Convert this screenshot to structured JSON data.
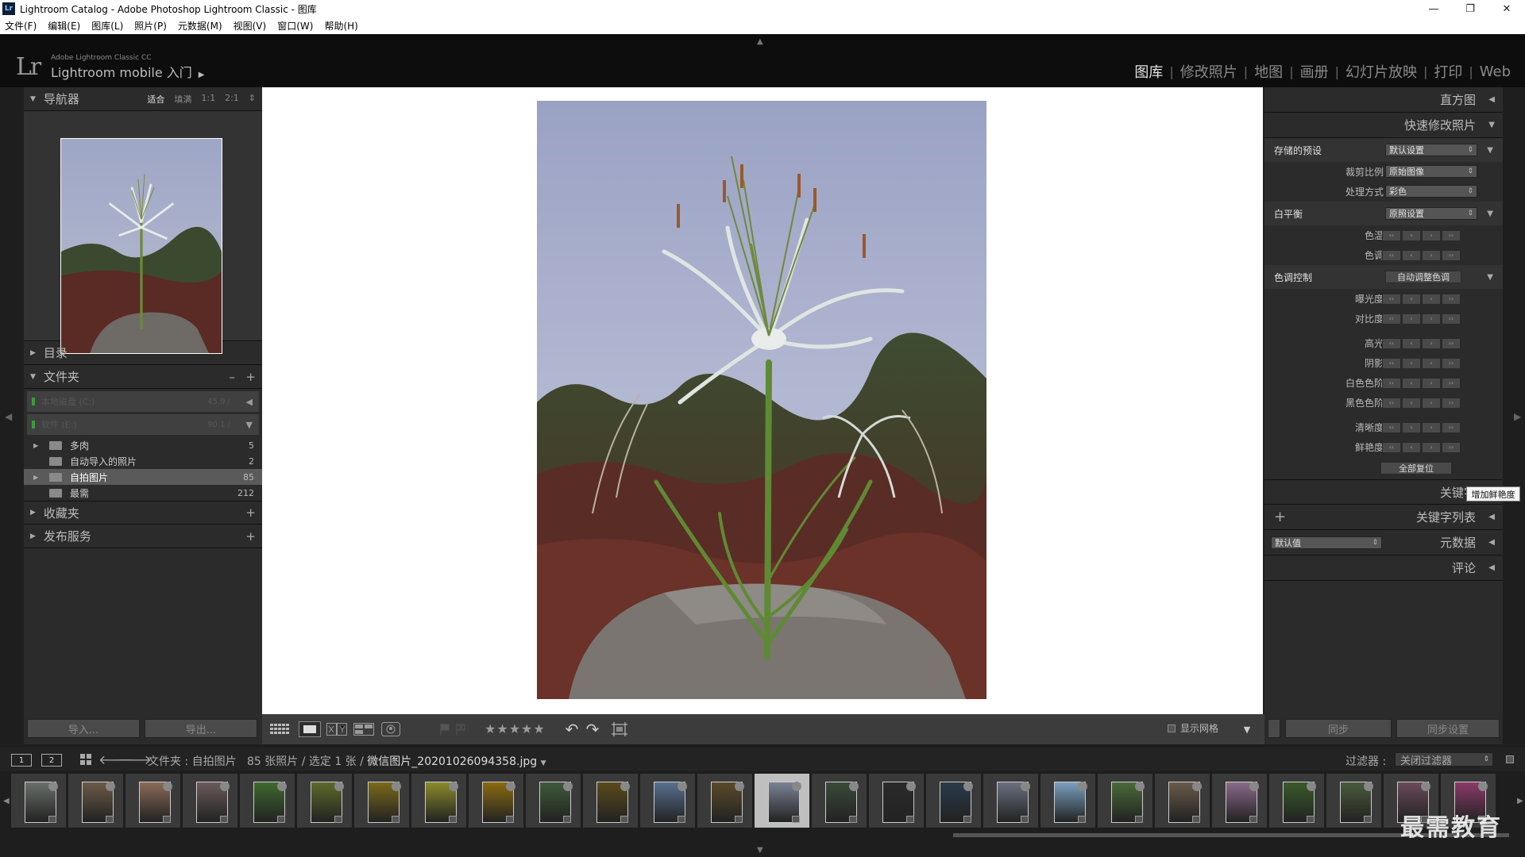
{
  "window": {
    "title": "Lightroom Catalog - Adobe Photoshop Lightroom Classic - 图库",
    "app_icon": "Lr",
    "controls": [
      "—",
      "❐",
      "✕"
    ]
  },
  "menu": [
    "文件(F)",
    "编辑(E)",
    "图库(L)",
    "照片(P)",
    "元数据(M)",
    "视图(V)",
    "窗口(W)",
    "帮助(H)"
  ],
  "identity": {
    "logo": "Lr",
    "product": "Adobe Lightroom Classic CC",
    "mobile": "Lightroom mobile 入门",
    "arrow": "▶"
  },
  "modules": [
    "图库",
    "修改照片",
    "地图",
    "画册",
    "幻灯片放映",
    "打印",
    "Web"
  ],
  "module_sep": "|",
  "left": {
    "navigator": {
      "title": "导航器",
      "options": [
        "适合",
        "填满",
        "1:1",
        "2:1"
      ],
      "arrow": "⇕"
    },
    "catalog": {
      "title": "目录"
    },
    "folders": {
      "title": "文件夹",
      "minus": "–",
      "plus": "+",
      "volumes": [
        {
          "name": "本地磁盘 (C:)",
          "cap": "45.9 /",
          "tri": "◀"
        },
        {
          "name": "软件 (E:)",
          "cap": "90.1 /",
          "tri": "▼"
        }
      ],
      "items": [
        {
          "name": "多肉",
          "count": "5",
          "tri": "▶"
        },
        {
          "name": "自动导入的照片",
          "count": "2",
          "tri": ""
        },
        {
          "name": "自拍图片",
          "count": "85",
          "tri": "▶"
        },
        {
          "name": "最需",
          "count": "212",
          "tri": ""
        }
      ]
    },
    "collections": {
      "title": "收藏夹",
      "plus": "+"
    },
    "publish": {
      "title": "发布服务",
      "plus": "+"
    },
    "import_btn": "导入...",
    "export_btn": "导出..."
  },
  "right": {
    "histogram": "直方图",
    "quick_develop": "快速修改照片",
    "saved_preset": {
      "label": "存储的预设",
      "value": "默认设置"
    },
    "crop": {
      "label": "裁剪比例",
      "value": "原始图像"
    },
    "treatment": {
      "label": "处理方式",
      "value": "彩色"
    },
    "white_balance": {
      "label": "白平衡",
      "value": "原照设置"
    },
    "wb_rows": [
      "色温",
      "色调"
    ],
    "tone": {
      "label": "色调控制",
      "button": "自动调整色调"
    },
    "tone_rows_1": [
      "曝光度",
      "对比度"
    ],
    "tone_rows_2": [
      "高光",
      "阴影",
      "白色色阶",
      "黑色色阶"
    ],
    "tone_rows_3": [
      "清晰度",
      "鲜艳度"
    ],
    "step_glyphs": [
      "‹‹",
      "‹",
      "›",
      "››"
    ],
    "reset": "全部复位",
    "tooltip": "增加鲜艳度",
    "keywording": "关键字",
    "keyword_list": "关键字列表",
    "metadata": {
      "label": "元数据",
      "preset": "默认值"
    },
    "comments": "评论",
    "sync_btn": "同步",
    "sync_settings_btn": "同步设置"
  },
  "toolbar": {
    "stars": "★★★★★",
    "show_grid": "显示网格"
  },
  "filmstrip": {
    "monitors": [
      "1",
      "2"
    ],
    "source": "文件夹 : 自拍图片",
    "count": "85 张照片 / 选定 1 张 /",
    "file": "微信图片_20201026094358.jpg",
    "filter_label": "过滤器 :",
    "filter_value": "关闭过滤器",
    "selected_index": 13,
    "thumb_colors": [
      "#6a6f6a",
      "#6b5a48",
      "#8a6a58",
      "#6a5a5a",
      "#3f6a2f",
      "#5c6a2a",
      "#7a6a1a",
      "#8a8a2a",
      "#8a6a10",
      "#3f5a3a",
      "#5a4a1a",
      "#587090",
      "#5a4a2a",
      "#7a8294",
      "#3a4a3a",
      "#2a2a2a",
      "#2a3a4a",
      "#6a7080",
      "#7aa0c0",
      "#4a6a3a",
      "#6a5a4a",
      "#8a6a8a",
      "#3a5a2a",
      "#4a5a3a",
      "#6a4a5a",
      "#8a3a6a"
    ]
  },
  "watermark": "最需教育",
  "icons": {
    "triangle_down": "▼",
    "triangle_right": "▶",
    "triangle_left": "◀",
    "collapse_up": "▲",
    "collapse_down": "▼"
  }
}
